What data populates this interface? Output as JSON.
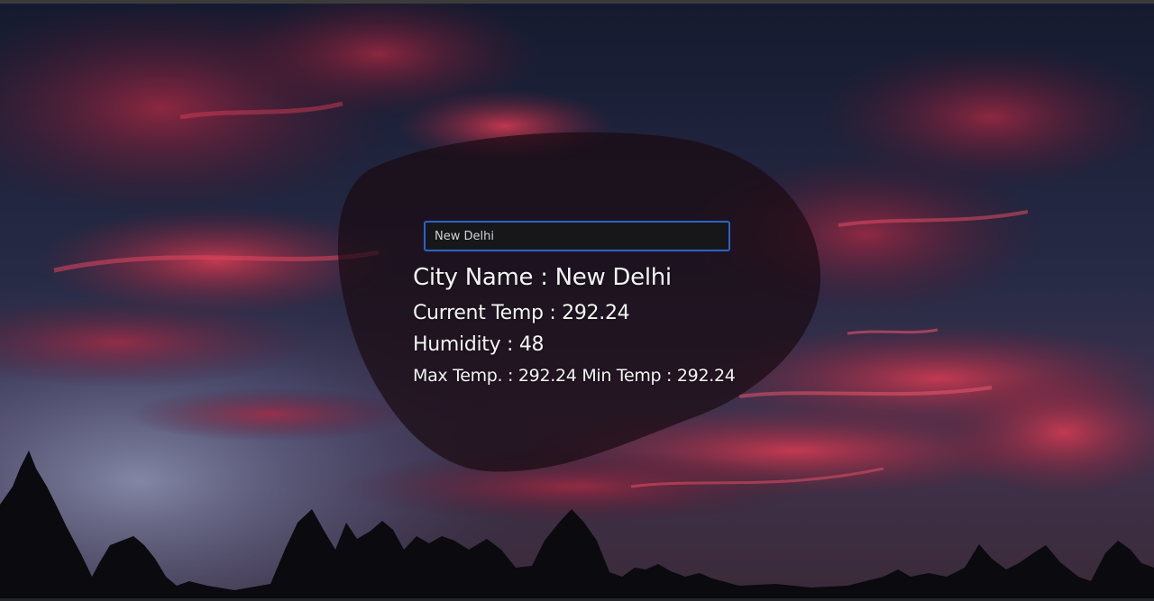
{
  "search": {
    "value": "New Delhi"
  },
  "weather": {
    "city_label": "City Name : ",
    "city": "New Delhi",
    "current_temp_label": "Current Temp : ",
    "current_temp": "292.24",
    "humidity_label": "Humidity : ",
    "humidity": "48",
    "max_temp_label": "Max Temp. : ",
    "max_temp": "292.24",
    "min_temp_label": " Min Temp : ",
    "min_temp": "292.24"
  },
  "colors": {
    "sky_dark": "#14172a",
    "cloud_red": "#c2344c",
    "card_overlay": "#1a0b12",
    "input_border": "#2a63c7",
    "text": "#f4f4f4"
  }
}
